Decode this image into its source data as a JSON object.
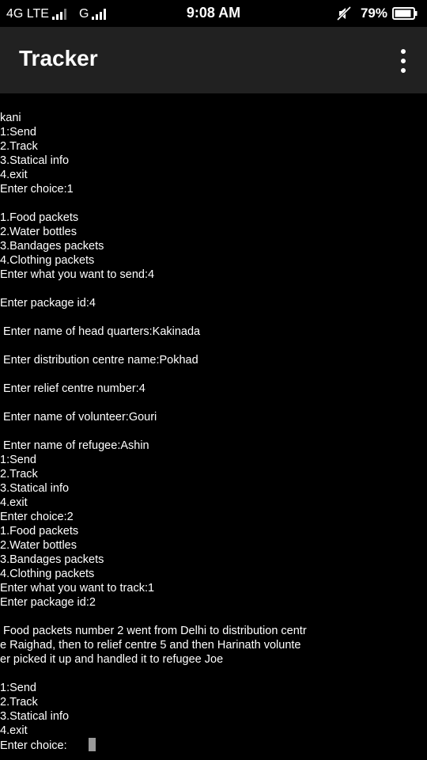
{
  "status_bar": {
    "network1": "4G LTE",
    "network2": "G",
    "time": "9:08 AM",
    "battery": "79%",
    "icons": [
      "signal-icon",
      "mute-icon",
      "battery-icon"
    ]
  },
  "app_bar": {
    "title": "Tracker",
    "menu_icon": "overflow-menu-icon"
  },
  "console": {
    "lines": [
      "kani",
      "1:Send",
      "2.Track",
      "3.Statical info",
      "4.exit",
      "Enter choice:1",
      "",
      "1.Food packets",
      "2.Water bottles",
      "3.Bandages packets",
      "4.Clothing packets",
      "Enter what you want to send:4",
      "",
      "Enter package id:4",
      "",
      " Enter name of head quarters:Kakinada",
      "",
      " Enter distribution centre name:Pokhad",
      "",
      " Enter relief centre number:4",
      "",
      " Enter name of volunteer:Gouri",
      "",
      " Enter name of refugee:Ashin",
      "1:Send",
      "2.Track",
      "3.Statical info",
      "4.exit",
      "Enter choice:2",
      "1.Food packets",
      "2.Water bottles",
      "3.Bandages packets",
      "4.Clothing packets",
      "Enter what you want to track:1",
      "Enter package id:2",
      "",
      " Food packets number 2 went from Delhi to distribution centr",
      "e Raighad, then to relief centre 5 and then Harinath volunte",
      "er picked it up and handled it to refugee Joe",
      "",
      "1:Send",
      "2.Track",
      "3.Statical info",
      "4.exit"
    ],
    "prompt": "Enter choice:"
  },
  "colors": {
    "background": "#000000",
    "app_bar": "#212121",
    "text": "#ffffff",
    "cursor": "#9a9a9a"
  }
}
